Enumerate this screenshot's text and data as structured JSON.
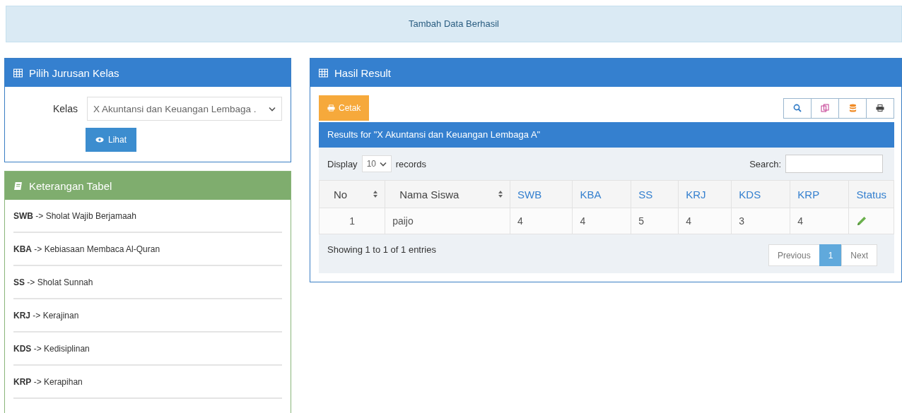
{
  "alert": {
    "text": "Tambah Data Berhasil"
  },
  "class_panel": {
    "title": "Pilih Jurusan Kelas",
    "label": "Kelas",
    "select_value": "X Akuntansi dan Keuangan Lembaga .",
    "button": "Lihat"
  },
  "legend_panel": {
    "title": "Keterangan Tabel",
    "items": [
      "**SWB** -> Sholat Wajib Berjamaah",
      "**KBA** -> Kebiasaan Membaca Al-Quran",
      "**SS** -> Sholat Sunnah",
      "**KRJ** -> Kerajinan",
      "**KDS** -> Kedisiplinan",
      "**KRP** -> Kerapihan"
    ]
  },
  "result_panel": {
    "title": "Hasil Result",
    "print_button": "Cetak",
    "results_heading": "Results for \"X Akuntansi dan Keuangan Lembaga A\"",
    "display_label": "Display",
    "display_value": "10",
    "records_label": "records",
    "search_label": "Search:",
    "columns": [
      {
        "label": "No",
        "kind": "sortable"
      },
      {
        "label": "Nama Siswa",
        "kind": "sortable"
      },
      {
        "label": "SWB",
        "kind": "link"
      },
      {
        "label": "KBA",
        "kind": "link"
      },
      {
        "label": "SS",
        "kind": "link"
      },
      {
        "label": "KRJ",
        "kind": "link"
      },
      {
        "label": "KDS",
        "kind": "link"
      },
      {
        "label": "KRP",
        "kind": "link"
      },
      {
        "label": "Status",
        "kind": "link"
      }
    ],
    "rows": [
      {
        "cells": [
          "1",
          "paijo",
          "4",
          "4",
          "5",
          "4",
          "3",
          "4"
        ]
      }
    ],
    "info": "Showing 1 to 1 of 1 entries",
    "pages": [
      {
        "label": "Previous",
        "selected": false
      },
      {
        "label": "1",
        "selected": true
      },
      {
        "label": "Next",
        "selected": false
      }
    ]
  }
}
